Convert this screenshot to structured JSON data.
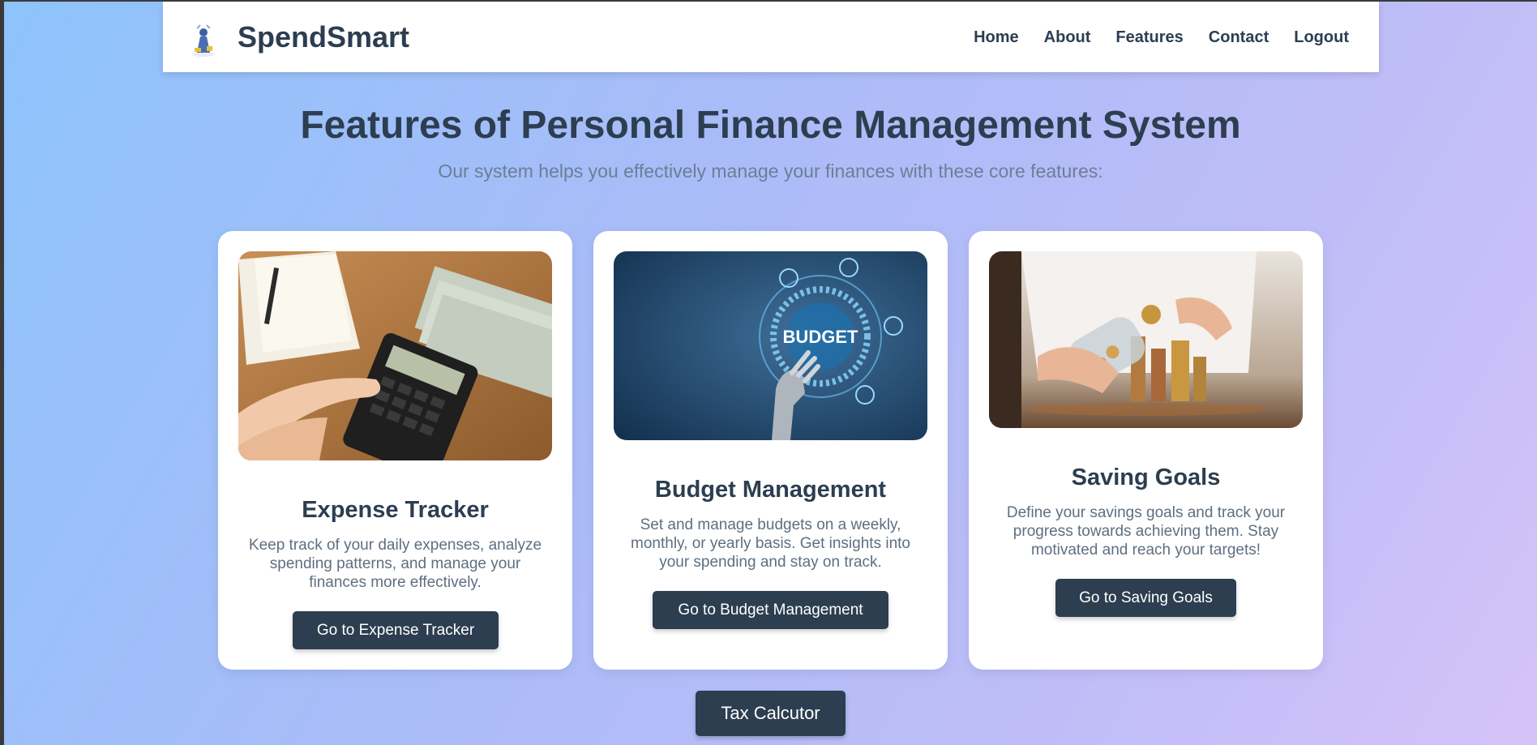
{
  "navbar": {
    "brand": "SpendSmart",
    "links": [
      "Home",
      "About",
      "Features",
      "Contact",
      "Logout"
    ]
  },
  "hero": {
    "title": "Features of Personal Finance Management System",
    "subtitle": "Our system helps you effectively manage your finances with these core features:"
  },
  "cards": [
    {
      "title": "Expense Tracker",
      "text_lines": [
        "Keep track of your daily expenses, analyze",
        "spending patterns, and manage your",
        "finances more effectively."
      ],
      "button": "Go to Expense Tracker"
    },
    {
      "title": "Budget Management",
      "text_lines": [
        "Set and manage budgets on a weekly,",
        "monthly, or yearly basis. Get insights into",
        "your spending and stay on track."
      ],
      "button": "Go to Budget Management",
      "image_text": "BUDGET"
    },
    {
      "title": "Saving Goals",
      "text_lines": [
        "Define your savings goals and track your",
        "progress towards achieving them. Stay",
        "motivated and reach your targets!"
      ],
      "button": "Go to Saving Goals"
    }
  ],
  "tax_button": "Tax Calcutor",
  "colors": {
    "primary": "#2c3e50",
    "subtitle": "#6b7f96",
    "card_text": "#5f6f80",
    "gradient_start": "#8ec3fb",
    "gradient_end": "#d6c2f9"
  },
  "icons": [
    "logo-icon"
  ]
}
